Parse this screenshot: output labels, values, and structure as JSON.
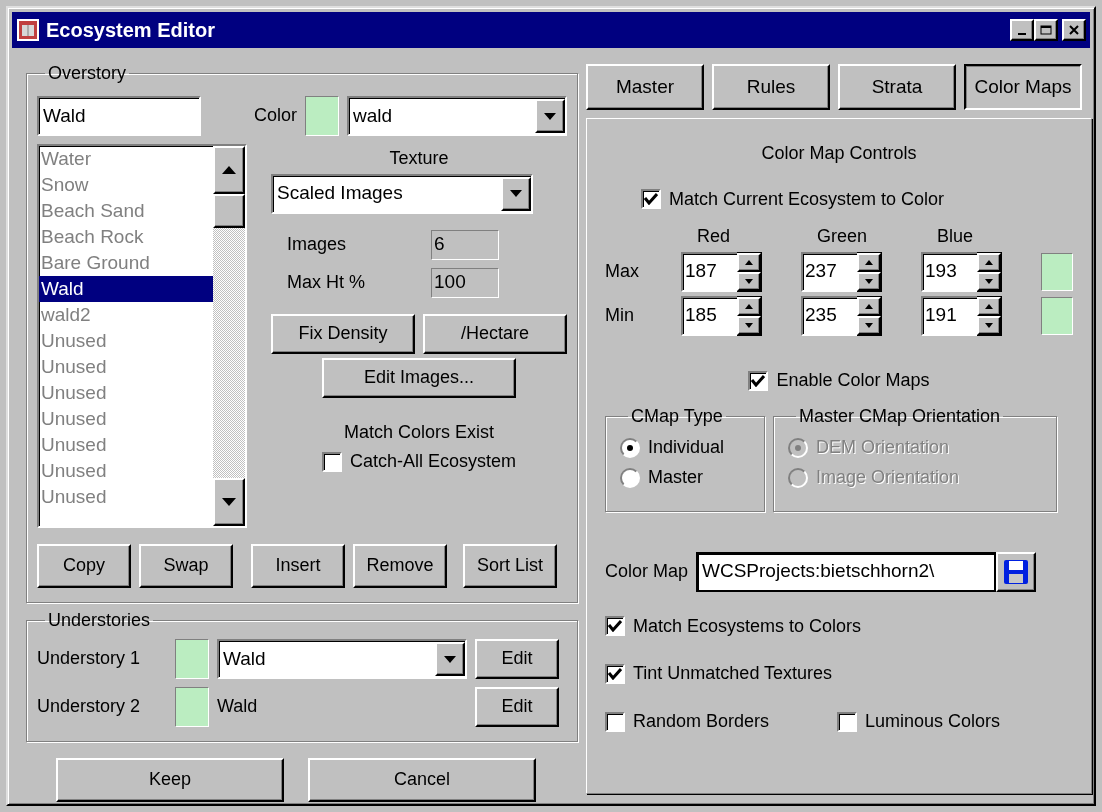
{
  "window": {
    "title": "Ecosystem Editor"
  },
  "overstory": {
    "label": "Overstory",
    "name_value": "Wald",
    "color_label": "Color",
    "color": "#bbedc1",
    "color_map_value": "wald",
    "ecosystems": [
      {
        "label": "Water",
        "selected": false,
        "dimmed": true
      },
      {
        "label": "Snow",
        "selected": false,
        "dimmed": true
      },
      {
        "label": "Beach Sand",
        "selected": false,
        "dimmed": true
      },
      {
        "label": "Beach Rock",
        "selected": false,
        "dimmed": true
      },
      {
        "label": "Bare Ground",
        "selected": false,
        "dimmed": true
      },
      {
        "label": "Wald",
        "selected": true,
        "dimmed": false
      },
      {
        "label": "wald2",
        "selected": false,
        "dimmed": true
      },
      {
        "label": "Unused",
        "selected": false,
        "dimmed": true
      },
      {
        "label": "Unused",
        "selected": false,
        "dimmed": true
      },
      {
        "label": "Unused",
        "selected": false,
        "dimmed": true
      },
      {
        "label": "Unused",
        "selected": false,
        "dimmed": true
      },
      {
        "label": "Unused",
        "selected": false,
        "dimmed": true
      },
      {
        "label": "Unused",
        "selected": false,
        "dimmed": true
      },
      {
        "label": "Unused",
        "selected": false,
        "dimmed": true
      }
    ],
    "texture_label": "Texture",
    "texture_value": "Scaled Images",
    "fields": [
      {
        "label": "Images",
        "value": "6"
      },
      {
        "label": "Max Ht %",
        "value": "100"
      }
    ],
    "density_buttons": [
      "Fix Density",
      "/Hectare"
    ],
    "edit_images_button": "Edit Images...",
    "match_note": "Match Colors Exist",
    "catch_all": {
      "label": "Catch-All Ecosystem",
      "checked": false
    },
    "list_buttons": [
      "Copy",
      "Swap",
      "Insert",
      "Remove",
      "Sort List"
    ]
  },
  "understories": {
    "label": "Understories",
    "rows": [
      {
        "label": "Understory 1",
        "color": "#bbedc1",
        "kind": "dropdown",
        "value": "Wald",
        "button": "Edit"
      },
      {
        "label": "Understory 2",
        "color": "#bbedc1",
        "kind": "text",
        "value": "Wald",
        "button": "Edit"
      }
    ]
  },
  "footer_buttons": [
    "Keep",
    "Cancel"
  ],
  "tabs": [
    {
      "label": "Master",
      "selected": false
    },
    {
      "label": "Rules",
      "selected": false
    },
    {
      "label": "Strata",
      "selected": false
    },
    {
      "label": "Color Maps",
      "selected": true
    }
  ],
  "color_maps": {
    "heading": "Color Map Controls",
    "match_current": {
      "label": "Match Current Ecosystem to Color",
      "checked": true
    },
    "channels": [
      "Red",
      "Green",
      "Blue"
    ],
    "ranges": [
      {
        "label": "Max",
        "values": [
          "187",
          "237",
          "193"
        ],
        "color": "#bbedc1"
      },
      {
        "label": "Min",
        "values": [
          "185",
          "235",
          "191"
        ],
        "color": "#bbedc1"
      }
    ],
    "enable": {
      "label": "Enable Color Maps",
      "checked": true
    },
    "cmap_type": {
      "label": "CMap Type",
      "disabled": false,
      "options": [
        {
          "label": "Individual",
          "selected": true
        },
        {
          "label": "Master",
          "selected": false
        }
      ]
    },
    "orientation": {
      "label": "Master CMap Orientation",
      "disabled": true,
      "options": [
        {
          "label": "DEM Orientation",
          "selected": true
        },
        {
          "label": "Image Orientation",
          "selected": false
        }
      ]
    },
    "color_map_label": "Color Map",
    "color_map_value": "WCSProjects:bietschhorn2\\",
    "options": [
      [
        {
          "label": "Match Ecosystems to Colors",
          "checked": true
        }
      ],
      [
        {
          "label": "Tint Unmatched Textures",
          "checked": true
        }
      ],
      [
        {
          "label": "Random Borders",
          "checked": false
        },
        {
          "label": "Luminous Colors",
          "checked": false
        }
      ]
    ]
  }
}
